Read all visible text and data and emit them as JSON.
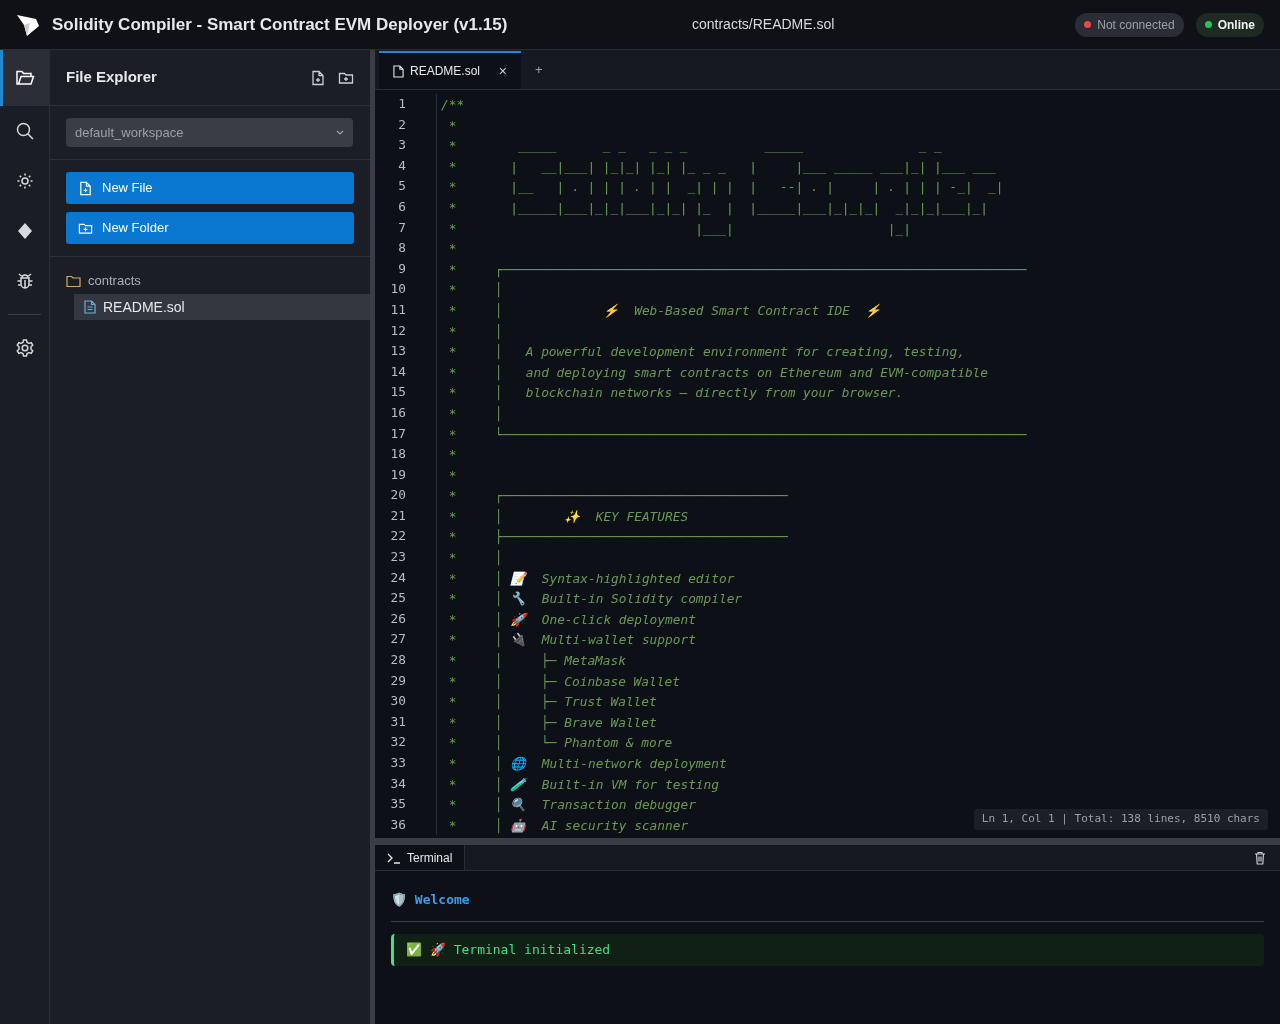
{
  "header": {
    "title": "Solidity Compiler - Smart Contract EVM Deployer (v1.15)",
    "file_path": "contracts/README.sol",
    "badges": [
      {
        "label": "Not connected",
        "kind": "muted",
        "color": "#e5484d"
      },
      {
        "label": "Online",
        "kind": "strong",
        "color": "#22c55e"
      }
    ]
  },
  "activity_bar": [
    {
      "kind": "files",
      "selected": true
    },
    {
      "kind": "search",
      "selected": false
    },
    {
      "kind": "compile",
      "selected": false
    },
    {
      "kind": "deploy",
      "selected": false
    },
    {
      "kind": "debug",
      "selected": false
    },
    {
      "kind": "settings",
      "selected": false
    }
  ],
  "sidebar": {
    "title": "File Explorer",
    "workspace": "default_workspace",
    "buttons": [
      {
        "label": "New File",
        "kind": "file"
      },
      {
        "label": "New Folder",
        "kind": "folder"
      }
    ],
    "tree": [
      {
        "label": "contracts",
        "kind": "folder",
        "selected": false,
        "children": [
          {
            "label": "README.sol",
            "kind": "file",
            "selected": true
          }
        ]
      }
    ]
  },
  "editor": {
    "tabs": [
      {
        "label": "README.sol",
        "close": "×",
        "selected": true
      }
    ],
    "new_tab": "+",
    "lines": [
      {
        "n": "1",
        "text": "/**"
      },
      {
        "n": "2",
        "text": " *"
      },
      {
        "n": "3",
        "text": " *        _____      _ _   _ _ _          _____               _ _"
      },
      {
        "n": "4",
        "text": " *       |   __|___| |_|_| |_| |_ _ _   |     |___ _____ ___|_| |___ ___"
      },
      {
        "n": "5",
        "text": " *       |__   | . | | | . | |  _| | |  |   --| . |     | . | | | -_|  _|"
      },
      {
        "n": "6",
        "text": " *       |_____|___|_|_|___|_|_| |_  |  |_____|___|_|_|_|  _|_|_|___|_|"
      },
      {
        "n": "7",
        "text": " *                               |___|                    |_|"
      },
      {
        "n": "8",
        "text": " *"
      },
      {
        "n": "9",
        "text": " *     ┌────────────────────────────────────────────────────────────────────"
      },
      {
        "n": "10",
        "text": " *     │"
      },
      {
        "n": "11",
        "text": " *     │             ⚡  Web-Based Smart Contract IDE  ⚡"
      },
      {
        "n": "12",
        "text": " *     │"
      },
      {
        "n": "13",
        "text": " *     │   A powerful development environment for creating, testing,"
      },
      {
        "n": "14",
        "text": " *     │   and deploying smart contracts on Ethereum and EVM-compatible"
      },
      {
        "n": "15",
        "text": " *     │   blockchain networks — directly from your browser."
      },
      {
        "n": "16",
        "text": " *     │"
      },
      {
        "n": "17",
        "text": " *     └────────────────────────────────────────────────────────────────────"
      },
      {
        "n": "18",
        "text": " *"
      },
      {
        "n": "19",
        "text": " *"
      },
      {
        "n": "20",
        "text": " *     ┌─────────────────────────────────────"
      },
      {
        "n": "21",
        "text": " *     │        ✨  KEY FEATURES"
      },
      {
        "n": "22",
        "text": " *     ├─────────────────────────────────────"
      },
      {
        "n": "23",
        "text": " *     │"
      },
      {
        "n": "24",
        "text": " *     │ 📝  Syntax-highlighted editor"
      },
      {
        "n": "25",
        "text": " *     │ 🔧  Built-in Solidity compiler"
      },
      {
        "n": "26",
        "text": " *     │ 🚀  One-click deployment"
      },
      {
        "n": "27",
        "text": " *     │ 🔌  Multi-wallet support"
      },
      {
        "n": "28",
        "text": " *     │     ├─ MetaMask"
      },
      {
        "n": "29",
        "text": " *     │     ├─ Coinbase Wallet"
      },
      {
        "n": "30",
        "text": " *     │     ├─ Trust Wallet"
      },
      {
        "n": "31",
        "text": " *     │     ├─ Brave Wallet"
      },
      {
        "n": "32",
        "text": " *     │     └─ Phantom & more"
      },
      {
        "n": "33",
        "text": " *     │ 🌐  Multi-network deployment"
      },
      {
        "n": "34",
        "text": " *     │ 🧪  Built-in VM for testing"
      },
      {
        "n": "35",
        "text": " *     │ 🔍  Transaction debugger"
      },
      {
        "n": "36",
        "text": " *     │ 🤖  AI security scanner"
      }
    ],
    "status": "Ln 1, Col 1 | Total: 138 lines, 8510 chars"
  },
  "terminal": {
    "tab": "Terminal",
    "messages": [
      {
        "kind": "heading",
        "text": "🛡️ Welcome"
      },
      {
        "kind": "success",
        "text": "✅ 🚀 Terminal initialized"
      }
    ]
  }
}
